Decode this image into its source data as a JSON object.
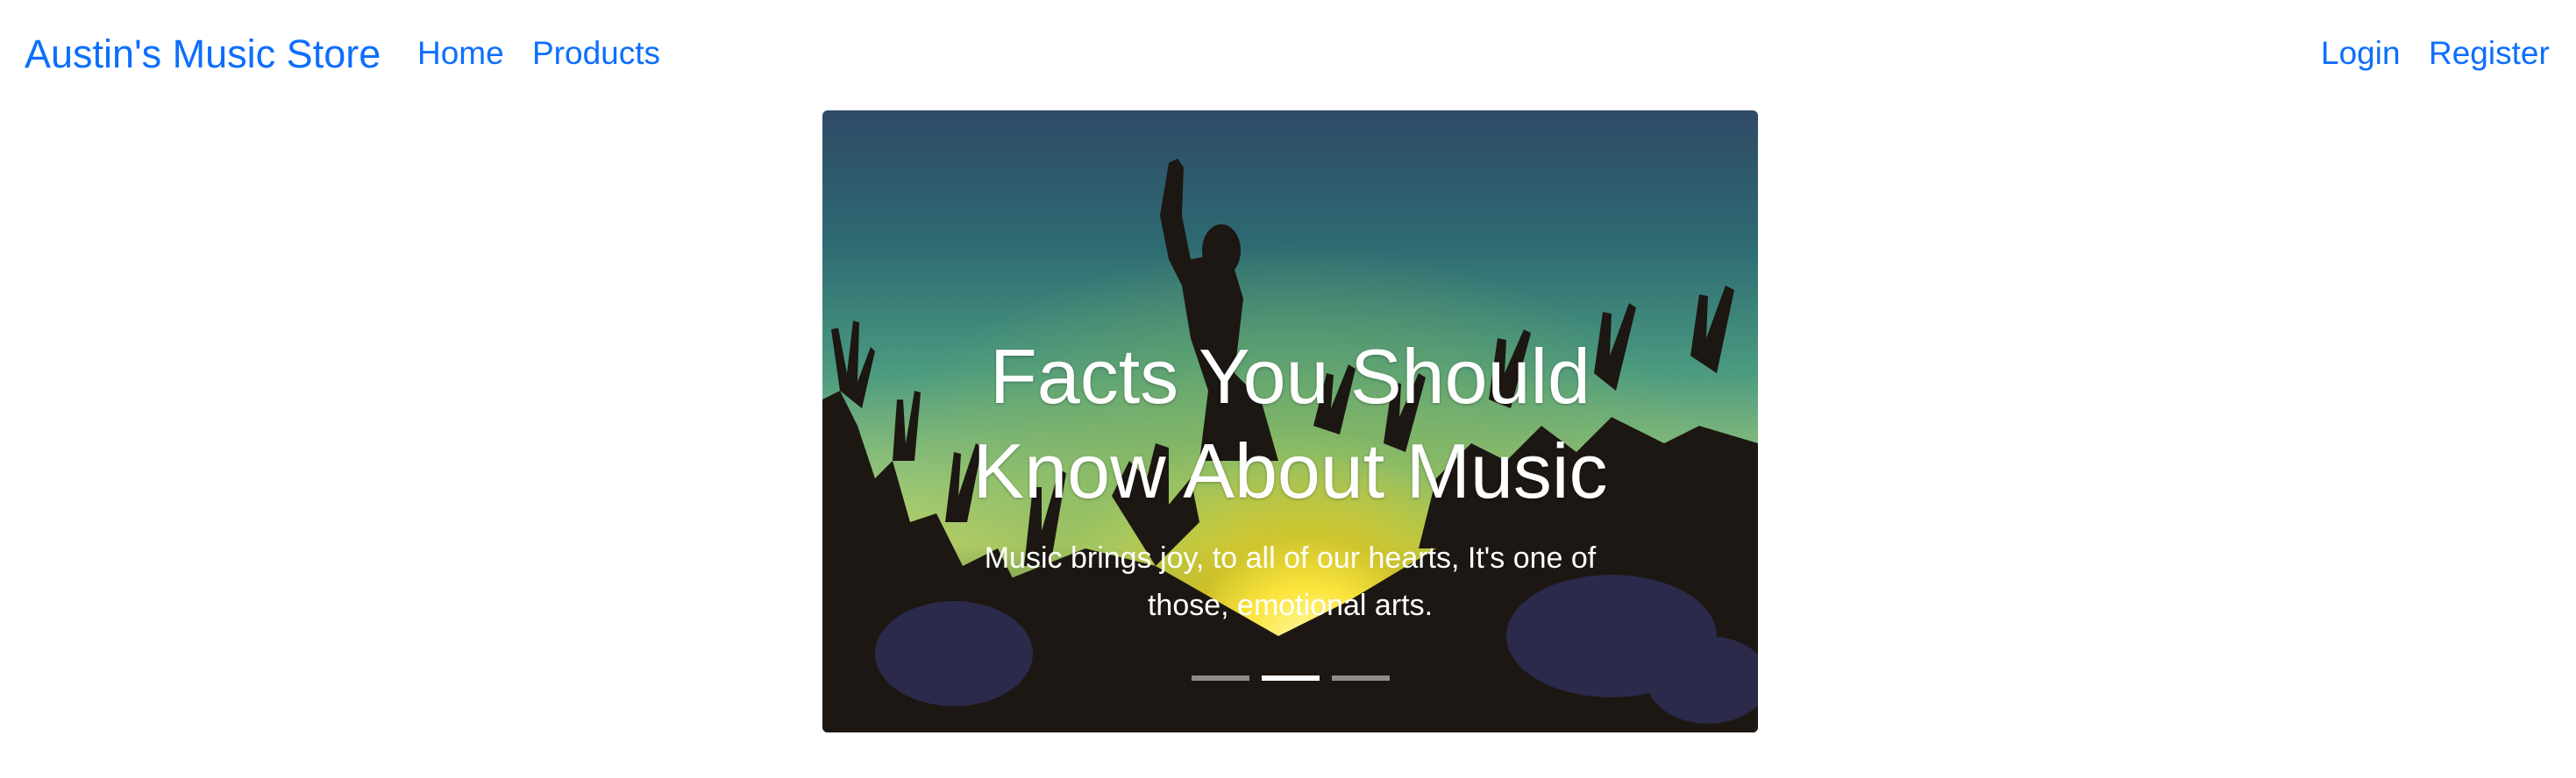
{
  "nav": {
    "brand": "Austin's Music Store",
    "links": [
      "Home",
      "Products"
    ],
    "auth": [
      "Login",
      "Register"
    ]
  },
  "carousel": {
    "title": "Facts You Should Know About Music",
    "text": "Music brings joy, to all of our hearts, It's one of those, emotional arts.",
    "slide_count": 3,
    "active_slide": 2
  },
  "colors": {
    "link": "#0d6efd",
    "caption_text": "#ffffff"
  }
}
